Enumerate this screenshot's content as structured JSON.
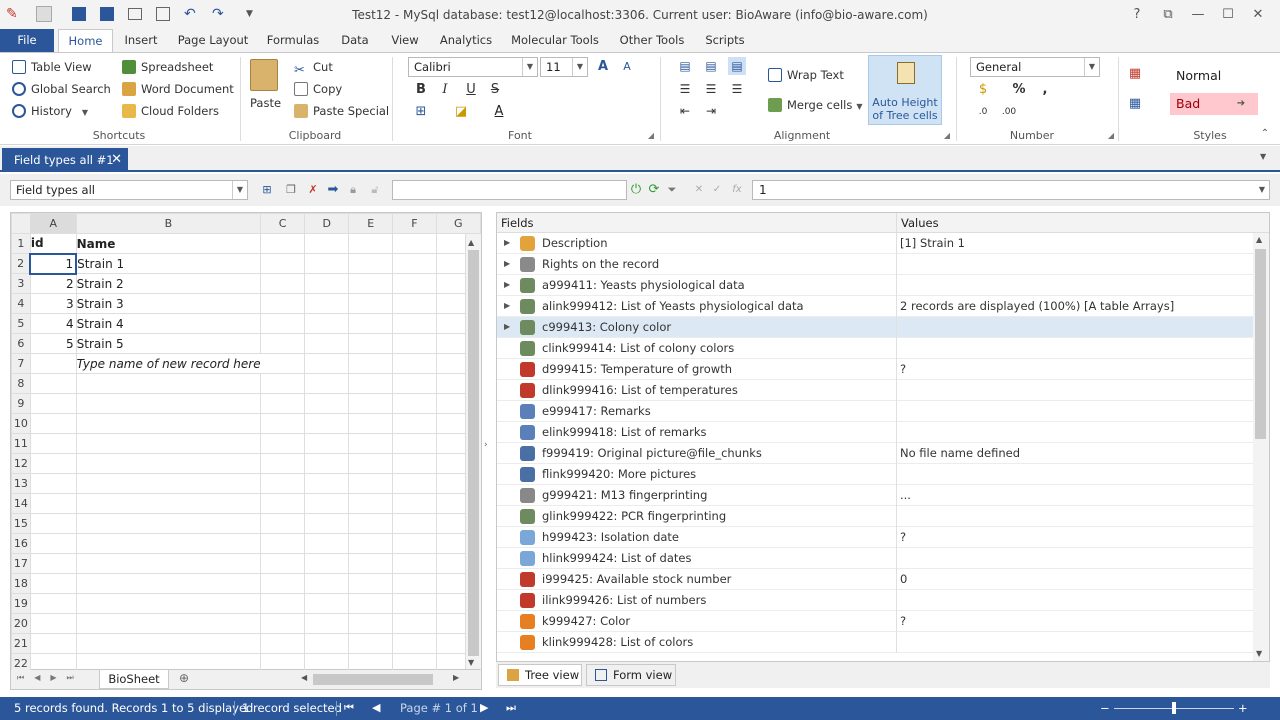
{
  "titlebar": {
    "title": "Test12 - MySql database: test12@localhost:3306. Current user: BioAware (info@bio-aware.com)",
    "help": "?"
  },
  "ribbon_tabs": [
    "File",
    "Home",
    "Insert",
    "Page Layout",
    "Formulas",
    "Data",
    "View",
    "Analytics",
    "Molecular Tools",
    "Other Tools",
    "Scripts"
  ],
  "shortcuts": {
    "table_view": "Table View",
    "spreadsheet": "Spreadsheet",
    "global_search": "Global Search",
    "word_document": "Word Document",
    "history": "History",
    "cloud_folders": "Cloud Folders",
    "label": "Shortcuts"
  },
  "clipboard": {
    "paste": "Paste",
    "cut": "Cut",
    "copy": "Copy",
    "paste_special": "Paste Special",
    "label": "Clipboard"
  },
  "font": {
    "name": "Calibri",
    "size": "11",
    "label": "Font"
  },
  "alignment": {
    "wrap_text": "Wrap Text",
    "merge_cells": "Merge cells",
    "auto_height_1": "Auto Height",
    "auto_height_2": "of Tree cells",
    "label": "Alignment"
  },
  "number": {
    "format": "General",
    "label": "Number"
  },
  "styles": {
    "normal": "Normal",
    "bad": "Bad",
    "label": "Styles"
  },
  "doc_tab": {
    "title": "Field types all #1"
  },
  "toolbar": {
    "view_select": "Field types all",
    "formula_value": "1"
  },
  "grid": {
    "columns": [
      "A",
      "B",
      "C",
      "D",
      "E",
      "F",
      "G"
    ],
    "rows": [
      {
        "n": "1",
        "a": "id",
        "b": "Name"
      },
      {
        "n": "2",
        "a": "1",
        "b": "Strain 1"
      },
      {
        "n": "3",
        "a": "2",
        "b": "Strain 2"
      },
      {
        "n": "4",
        "a": "3",
        "b": "Strain 3"
      },
      {
        "n": "5",
        "a": "4",
        "b": "Strain 4"
      },
      {
        "n": "6",
        "a": "5",
        "b": "Strain 5"
      },
      {
        "n": "7",
        "a": "",
        "b": "Type name of new record here"
      },
      {
        "n": "8",
        "a": "",
        "b": ""
      },
      {
        "n": "9",
        "a": "",
        "b": ""
      },
      {
        "n": "10",
        "a": "",
        "b": ""
      },
      {
        "n": "11",
        "a": "",
        "b": ""
      },
      {
        "n": "12",
        "a": "",
        "b": ""
      },
      {
        "n": "13",
        "a": "",
        "b": ""
      },
      {
        "n": "14",
        "a": "",
        "b": ""
      },
      {
        "n": "15",
        "a": "",
        "b": ""
      },
      {
        "n": "16",
        "a": "",
        "b": ""
      },
      {
        "n": "17",
        "a": "",
        "b": ""
      },
      {
        "n": "18",
        "a": "",
        "b": ""
      },
      {
        "n": "19",
        "a": "",
        "b": ""
      },
      {
        "n": "20",
        "a": "",
        "b": ""
      },
      {
        "n": "21",
        "a": "",
        "b": ""
      },
      {
        "n": "22",
        "a": "",
        "b": ""
      }
    ],
    "sheet_tab": "BioSheet"
  },
  "fields_panel": {
    "col_fields": "Fields",
    "col_values": "Values",
    "rows": [
      {
        "name": "Description",
        "value": "[1] Strain 1",
        "icon": "folder-icon",
        "color": "#e3a33c",
        "expand": true
      },
      {
        "name": "Rights on the record",
        "value": "",
        "icon": "eye-icon",
        "color": "#8a8a8a",
        "expand": true
      },
      {
        "name": "a999411: Yeasts physiological data",
        "value": "",
        "icon": "link-icon",
        "color": "#6d8b5e",
        "expand": true
      },
      {
        "name": "alink999412: List of Yeasts physiological data",
        "value": "2 records are displayed (100%) [A table Arrays]",
        "icon": "link-icon",
        "color": "#6d8b5e",
        "expand": true
      },
      {
        "name": "c999413: Colony color",
        "value": "",
        "icon": "link-icon",
        "color": "#6d8b5e",
        "expand": true
      },
      {
        "name": "clink999414: List of colony colors",
        "value": "",
        "icon": "link-icon",
        "color": "#6d8b5e",
        "expand": false
      },
      {
        "name": "d999415: Temperature of growth",
        "value": "?",
        "icon": "thermometer-icon",
        "color": "#c0392b",
        "expand": false
      },
      {
        "name": "dlink999416: List of temperatures",
        "value": "",
        "icon": "thermometer-icon",
        "color": "#c0392b",
        "expand": false
      },
      {
        "name": "e999417: Remarks",
        "value": "",
        "icon": "note-icon",
        "color": "#5b7fb8",
        "expand": false
      },
      {
        "name": "elink999418: List of remarks",
        "value": "",
        "icon": "note-icon",
        "color": "#5b7fb8",
        "expand": false
      },
      {
        "name": "f999419: Original picture@file_chunks",
        "value": "No file name defined",
        "icon": "picture-icon",
        "color": "#4a6fa5",
        "expand": false
      },
      {
        "name": "flink999420: More pictures",
        "value": "",
        "icon": "picture-icon",
        "color": "#4a6fa5",
        "expand": false
      },
      {
        "name": "g999421: M13 fingerprinting",
        "value": "...",
        "icon": "dots-icon",
        "color": "#888888",
        "expand": false
      },
      {
        "name": "glink999422: PCR fingerprinting",
        "value": "",
        "icon": "dots-icon",
        "color": "#6d8b5e",
        "expand": false
      },
      {
        "name": "h999423: Isolation date",
        "value": "?",
        "icon": "clock-icon",
        "color": "#7aa7d8",
        "expand": false
      },
      {
        "name": "hlink999424: List of dates",
        "value": "",
        "icon": "clock-icon",
        "color": "#7aa7d8",
        "expand": false
      },
      {
        "name": "i999425: Available stock number",
        "value": "0",
        "icon": "pin-icon",
        "color": "#c0392b",
        "expand": false
      },
      {
        "name": "ilink999426: List of numbers",
        "value": "",
        "icon": "pin-icon",
        "color": "#c0392b",
        "expand": false
      },
      {
        "name": "k999427: Color",
        "value": "?",
        "icon": "color-wheel-icon",
        "color": "#e67e22",
        "expand": false
      },
      {
        "name": "klink999428: List of colors",
        "value": "",
        "icon": "color-wheel-icon",
        "color": "#e67e22",
        "expand": false
      }
    ],
    "tree_view": "Tree view",
    "form_view": "Form view"
  },
  "status": {
    "records": "5 records found. Records 1 to 5 displayed",
    "selected": "1 record selected",
    "page": "Page # 1 of 1"
  },
  "colors": {
    "accent": "#2b579a",
    "selected_row": "#dde8f5",
    "bad_bg": "#ffc7ce",
    "bad_fg": "#9c0006"
  }
}
